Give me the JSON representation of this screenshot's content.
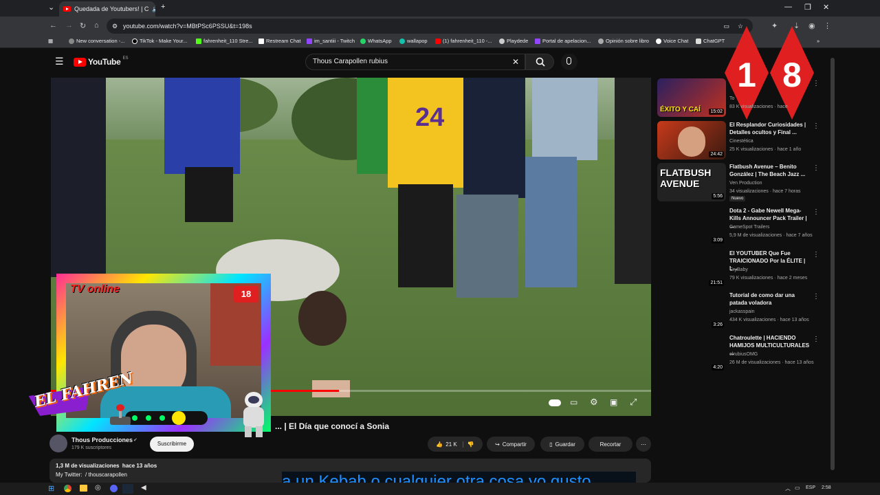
{
  "browser": {
    "tab_title": "Quedada de Youtubers! | C",
    "url": "youtube.com/watch?v=MBtPSc6PSSU&t=198s",
    "bookmarks": [
      "New conversation -...",
      "TikTok - Make Your...",
      "fahrenheit_110 Stre...",
      "Restream Chat",
      "im_santiii - Twitch",
      "WhatsApp",
      "wallapop",
      "(1) fahrenheit_110 -...",
      "Playdede",
      "Portal de apelacion...",
      "Opinión sobre libro",
      "Voice Chat",
      "ChatGPT"
    ]
  },
  "youtube": {
    "logo": "YouTube",
    "region": "ES",
    "search_value": "Thous Carapollen rubius"
  },
  "video": {
    "title_visible": "... | El Día que conocí a Sonia",
    "channel": "Thous Producciones",
    "subscribers": "179 K suscriptores",
    "subscribe_label": "Suscribirme",
    "likes": "21 K",
    "share": "Compartir",
    "save": "Guardar",
    "clip": "Recortar",
    "views_date": "1,3 M de visualizaciones  hace 13 años",
    "description_line": "My Twitter:  / thouscarapollen",
    "progress_pct": 48
  },
  "overlay": {
    "stream_label": "TV online",
    "badge": "18",
    "brand": "EL FAHREN",
    "subtitle": "a un Kebab o cualquier otra cosa yo gusto"
  },
  "recommendations": [
    {
      "title": "",
      "channel": "To",
      "meta": "83 K visualizaciones · hace",
      "duration": "15:02",
      "thumb_text": "ÉXITO Y CAÍ"
    },
    {
      "title": "El Resplandor  Curiosidades | Detalles ocultos y Final ...",
      "channel": "Cinestética",
      "meta": "25 K visualizaciones · hace 1 año",
      "duration": "24:42",
      "thumb_text": ""
    },
    {
      "title": "Flatbush Avenue – Benito González | The Beach Jazz ...",
      "channel": "Ven Production",
      "meta": "34 visualizaciones · hace 7 horas",
      "duration": "5:56",
      "thumb_text": "FLATBUSH AVENUE",
      "badge": "Nuevo"
    },
    {
      "title": "Dota 2 - Gabe Newell Mega-Kills Announcer Pack Trailer | ...",
      "channel": "GameSpot Trailers",
      "meta": "5,9 M de visualizaciones · hace 7 años",
      "duration": "3:09",
      "thumb_text": ""
    },
    {
      "title": "El YOUTUBER Que Fue TRAICIONADO Por la ÉLITE | L...",
      "channel": "CryBaby",
      "meta": "79 K visualizaciones · hace 2 meses",
      "duration": "21:51",
      "thumb_text": ""
    },
    {
      "title": "Tutorial de como dar una patada voladora",
      "channel": "jackasspain",
      "meta": "434 K visualizaciones · hace 13 años",
      "duration": "3:26",
      "thumb_text": ""
    },
    {
      "title": "Chatroulette | HACIENDO HAMIJOS MULTICULTURALES ...",
      "channel": "elrubiusOMG",
      "meta": "26 M de visualizaciones · hace 13 años",
      "duration": "4:20",
      "thumb_text": ""
    }
  ],
  "taskbar": {
    "lang": "ESP",
    "time": "2:58"
  },
  "colors": {
    "yt_red": "#ff0000",
    "bg": "#0f0f0f",
    "badge_red": "#e02020"
  }
}
